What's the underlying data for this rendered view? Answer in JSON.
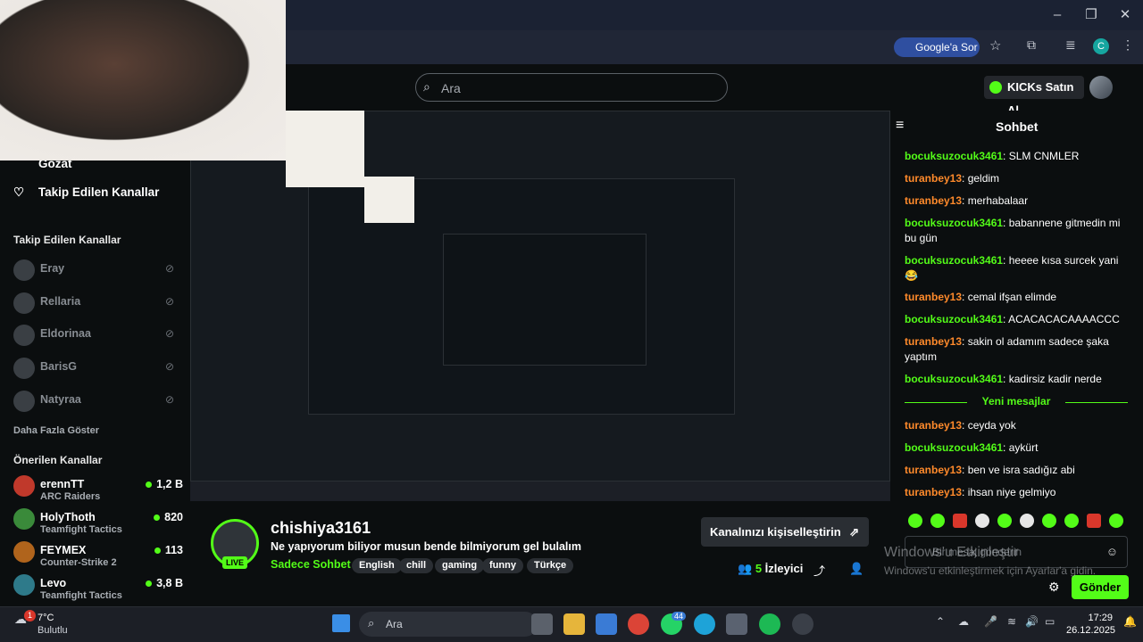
{
  "browser": {
    "ask_google": "Google'a Sor",
    "profile_initial": "C"
  },
  "header": {
    "search_placeholder": "Ara",
    "kicks_button": "KICKs Satın Al"
  },
  "sidebar": {
    "browse": "Gözat",
    "following_nav": "Takip Edilen Kanallar",
    "following_title": "Takip Edilen Kanallar",
    "following": [
      {
        "name": "Eray"
      },
      {
        "name": "Rellaria"
      },
      {
        "name": "Eldorinaa"
      },
      {
        "name": "BarisG"
      },
      {
        "name": "Natyraa"
      }
    ],
    "show_more": "Daha Fazla Göster",
    "recommended_title": "Önerilen Kanallar",
    "recommended": [
      {
        "name": "erennTT",
        "game": "ARC Raiders",
        "viewers": "1,2 B"
      },
      {
        "name": "HolyThoth",
        "game": "Teamfight Tactics",
        "viewers": "820"
      },
      {
        "name": "FEYMEX",
        "game": "Counter-Strike 2",
        "viewers": "113"
      },
      {
        "name": "Levo",
        "game": "Teamfight Tactics",
        "viewers": "3,8 B"
      }
    ]
  },
  "stream": {
    "name": "chishiya3161",
    "title": "Ne yapıyorum biliyor musun bende bilmiyorum gel bulalım",
    "category": "Sadece Sohbet",
    "tags": [
      "English",
      "chill",
      "gaming",
      "funny",
      "Türkçe"
    ],
    "live": "LIVE",
    "customize": "Kanalınızı kişiselleştirin",
    "viewers": "5",
    "viewers_label": "İzleyici"
  },
  "chat": {
    "title": "Sohbet",
    "messages": [
      {
        "user": "bocuksuzocuk3461",
        "text": "SLM CNMLER",
        "color": "g"
      },
      {
        "user": "turanbey13",
        "text": "geldim",
        "color": "o"
      },
      {
        "user": "turanbey13",
        "text": "merhabalaar",
        "color": "o"
      },
      {
        "user": "bocuksuzocuk3461",
        "text": "babannene gitmedin mi bu gün",
        "color": "g"
      },
      {
        "user": "bocuksuzocuk3461",
        "text": "heeee kısa surcek yani 😂",
        "color": "g"
      },
      {
        "user": "turanbey13",
        "text": "cemal ifşan elimde",
        "color": "o"
      },
      {
        "user": "bocuksuzocuk3461",
        "text": "ACACACACAAAACCC",
        "color": "g"
      },
      {
        "user": "turanbey13",
        "text": "sakin ol adamım sadece şaka yaptım",
        "color": "o"
      },
      {
        "user": "bocuksuzocuk3461",
        "text": "kadirsiz kadir nerde",
        "color": "g"
      }
    ],
    "new_messages": "Yeni mesajlar",
    "new": [
      {
        "user": "turanbey13",
        "text": "ceyda yok",
        "color": "o"
      },
      {
        "user": "bocuksuzocuk3461",
        "text": "aykürt",
        "color": "g"
      },
      {
        "user": "turanbey13",
        "text": "ben ve isra sadığız abi",
        "color": "o"
      },
      {
        "user": "turanbey13",
        "text": "ihsan niye gelmiyo",
        "color": "o"
      }
    ],
    "input_placeholder": "Bir mesaj gönderin",
    "send": "Gönder"
  },
  "watermark": {
    "line1": "Windows'u Etkinleştir",
    "line2": "Windows'u etkinleştirmek için Ayarlar'a gidin."
  },
  "taskbar": {
    "temp": "7°C",
    "weather": "Bulutlu",
    "search": "Ara",
    "time": "17:29",
    "date": "26.12.2025",
    "badge": "1",
    "whatsapp_badge": "44"
  },
  "colors": {
    "accent": "#53fc18",
    "orange_user": "#ff8a2b",
    "bg": "#0b0e0f"
  }
}
